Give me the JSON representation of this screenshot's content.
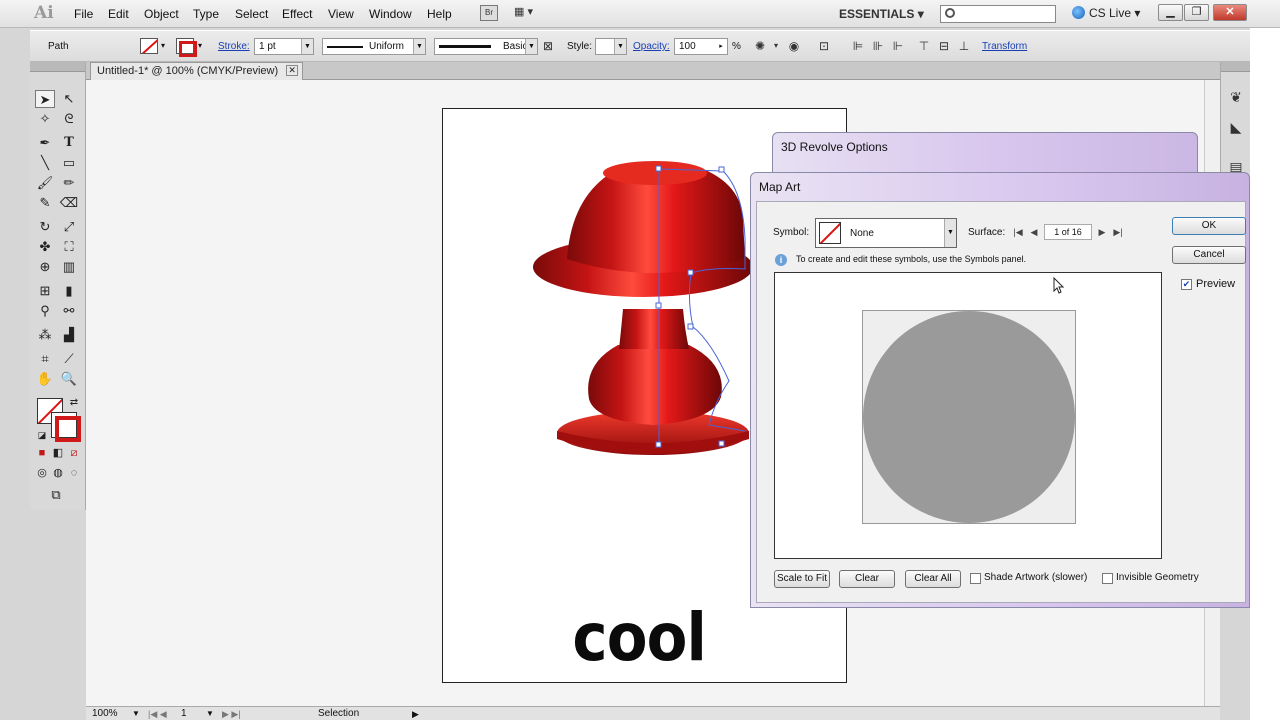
{
  "app": {
    "logo": "Ai",
    "menu": [
      "File",
      "Edit",
      "Object",
      "Type",
      "Select",
      "Effect",
      "View",
      "Window",
      "Help"
    ],
    "bridge_label": "Br",
    "workspace": "ESSENTIALS",
    "cs_live": "CS Live"
  },
  "control_bar": {
    "selection_type": "Path",
    "stroke_label": "Stroke:",
    "stroke_weight": "1 pt",
    "profile": "Uniform",
    "brush": "Basic",
    "style_label": "Style:",
    "opacity_label": "Opacity:",
    "opacity_value": "100",
    "opacity_unit": "%",
    "transform_link": "Transform"
  },
  "document": {
    "tab_title": "Untitled-1* @ 100% (CMYK/Preview)",
    "text_art": "cool"
  },
  "status_bar": {
    "zoom": "100%",
    "artboard": "1",
    "tool": "Selection"
  },
  "dialog_back": {
    "title": "3D Revolve Options"
  },
  "map_art": {
    "title": "Map Art",
    "symbol_label": "Symbol:",
    "symbol_value": "None",
    "surface_label": "Surface:",
    "surface_value": "1 of 16",
    "info_text": "To create and edit these symbols, use the Symbols panel.",
    "buttons": {
      "ok": "OK",
      "cancel": "Cancel",
      "scale_to_fit": "Scale to Fit",
      "clear": "Clear",
      "clear_all": "Clear All"
    },
    "options": {
      "preview": "Preview",
      "preview_checked": true,
      "shade_artwork": "Shade Artwork (slower)",
      "invisible_geometry": "Invisible Geometry"
    }
  },
  "colors": {
    "accent": "#1a3fb4",
    "object_red": "#d81b1b",
    "surface_gray": "#9a9a9a"
  }
}
